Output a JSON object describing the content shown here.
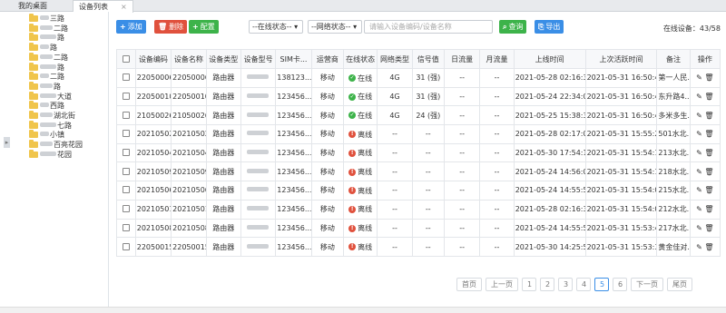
{
  "tabs": {
    "home": "我的桌面",
    "device_list": "设备列表",
    "close": "×"
  },
  "sidebar": {
    "items": [
      {
        "label": "三路"
      },
      {
        "label": "二路"
      },
      {
        "label": "路"
      },
      {
        "label": "路"
      },
      {
        "label": "二路"
      },
      {
        "label": "路"
      },
      {
        "label": "二路"
      },
      {
        "label": "路"
      },
      {
        "label": "大道"
      },
      {
        "label": "西路"
      },
      {
        "label": "湖北街"
      },
      {
        "label": "七路"
      },
      {
        "label": "小镇"
      },
      {
        "label": "百亮花园"
      },
      {
        "label": "花园"
      }
    ]
  },
  "toolbar": {
    "add_label": "添加",
    "delete_label": "删除",
    "config_label": "配置",
    "online_state_select": "--在线状态--",
    "network_state_select": "--网络状态--",
    "search_placeholder": "请输入设备编码/设备名称",
    "query_label": "查询",
    "export_label": "导出",
    "online_count": "在线设备：43/58"
  },
  "table": {
    "headers": [
      "设备编码",
      "设备名称",
      "设备类型",
      "设备型号",
      "SIM卡...",
      "运营商",
      "在线状态",
      "网络类型",
      "信号值",
      "日流量",
      "月流量",
      "上线时间",
      "上次活跃时间",
      "备注",
      "操作"
    ],
    "rows": [
      {
        "code": "22050006",
        "name": "22050006",
        "type": "路由器",
        "sim": "138123...",
        "carrier": "移动",
        "status": "在线",
        "online": true,
        "net": "4G",
        "signal": "31 (强)",
        "day": "--",
        "month": "--",
        "up": "2021-05-28 02:16:36",
        "last": "2021-05-31 16:50:41",
        "note": "第一人民..."
      },
      {
        "code": "22050010",
        "name": "22050010",
        "type": "路由器",
        "sim": "123456...",
        "carrier": "移动",
        "status": "在线",
        "online": true,
        "net": "4G",
        "signal": "31 (强)",
        "day": "--",
        "month": "--",
        "up": "2021-05-24 22:34:09",
        "last": "2021-05-31 16:50:41",
        "note": "东升路4..."
      },
      {
        "code": "21050026",
        "name": "21050026",
        "type": "路由器",
        "sim": "123456...",
        "carrier": "移动",
        "status": "在线",
        "online": true,
        "net": "4G",
        "signal": "24 (强)",
        "day": "--",
        "month": "--",
        "up": "2021-05-25 15:38:39",
        "last": "2021-05-31 16:50:41",
        "note": "多米多生..."
      },
      {
        "code": "20210502",
        "name": "20210502",
        "type": "路由器",
        "sim": "123456...",
        "carrier": "移动",
        "status": "离线",
        "online": false,
        "net": "--",
        "signal": "--",
        "day": "--",
        "month": "--",
        "up": "2021-05-28 02:17:05",
        "last": "2021-05-31 15:55:21",
        "note": "501水北..."
      },
      {
        "code": "20210504",
        "name": "20210504",
        "type": "路由器",
        "sim": "123456...",
        "carrier": "移动",
        "status": "离线",
        "online": false,
        "net": "--",
        "signal": "--",
        "day": "--",
        "month": "--",
        "up": "2021-05-30 17:54:14",
        "last": "2021-05-31 15:54:19",
        "note": "213水北..."
      },
      {
        "code": "20210509",
        "name": "20210509",
        "type": "路由器",
        "sim": "123456...",
        "carrier": "移动",
        "status": "离线",
        "online": false,
        "net": "--",
        "signal": "--",
        "day": "--",
        "month": "--",
        "up": "2021-05-24 14:56:06",
        "last": "2021-05-31 15:54:17",
        "note": "218水北..."
      },
      {
        "code": "20210506",
        "name": "20210506",
        "type": "路由器",
        "sim": "123456...",
        "carrier": "移动",
        "status": "离线",
        "online": false,
        "net": "--",
        "signal": "--",
        "day": "--",
        "month": "--",
        "up": "2021-05-24 14:55:59",
        "last": "2021-05-31 15:54:09",
        "note": "215水北..."
      },
      {
        "code": "20210501",
        "name": "20210501",
        "type": "路由器",
        "sim": "123456...",
        "carrier": "移动",
        "status": "离线",
        "online": false,
        "net": "--",
        "signal": "--",
        "day": "--",
        "month": "--",
        "up": "2021-05-28 02:16:31",
        "last": "2021-05-31 15:54:07",
        "note": "212水北..."
      },
      {
        "code": "20210508",
        "name": "20210508",
        "type": "路由器",
        "sim": "123456...",
        "carrier": "移动",
        "status": "离线",
        "online": false,
        "net": "--",
        "signal": "--",
        "day": "--",
        "month": "--",
        "up": "2021-05-24 14:55:59",
        "last": "2021-05-31 15:53:44",
        "note": "217水北..."
      },
      {
        "code": "22050015",
        "name": "22050015",
        "type": "路由器",
        "sim": "123456...",
        "carrier": "移动",
        "status": "离线",
        "online": false,
        "net": "--",
        "signal": "--",
        "day": "--",
        "month": "--",
        "up": "2021-05-30 14:25:53",
        "last": "2021-05-31 15:53:37",
        "note": "黄金佳对..."
      }
    ]
  },
  "pager": {
    "first": "首页",
    "prev": "上一页",
    "pages": [
      "1",
      "2",
      "3",
      "4",
      "5",
      "6"
    ],
    "current": "5",
    "next": "下一页",
    "last": "尾页"
  },
  "colors": {
    "add": "#3a8ee6",
    "delete": "#e0513d",
    "config": "#3db34a",
    "query": "#3db34a",
    "export": "#3a8ee6",
    "online": "#3db34a",
    "offline": "#e0513d"
  }
}
